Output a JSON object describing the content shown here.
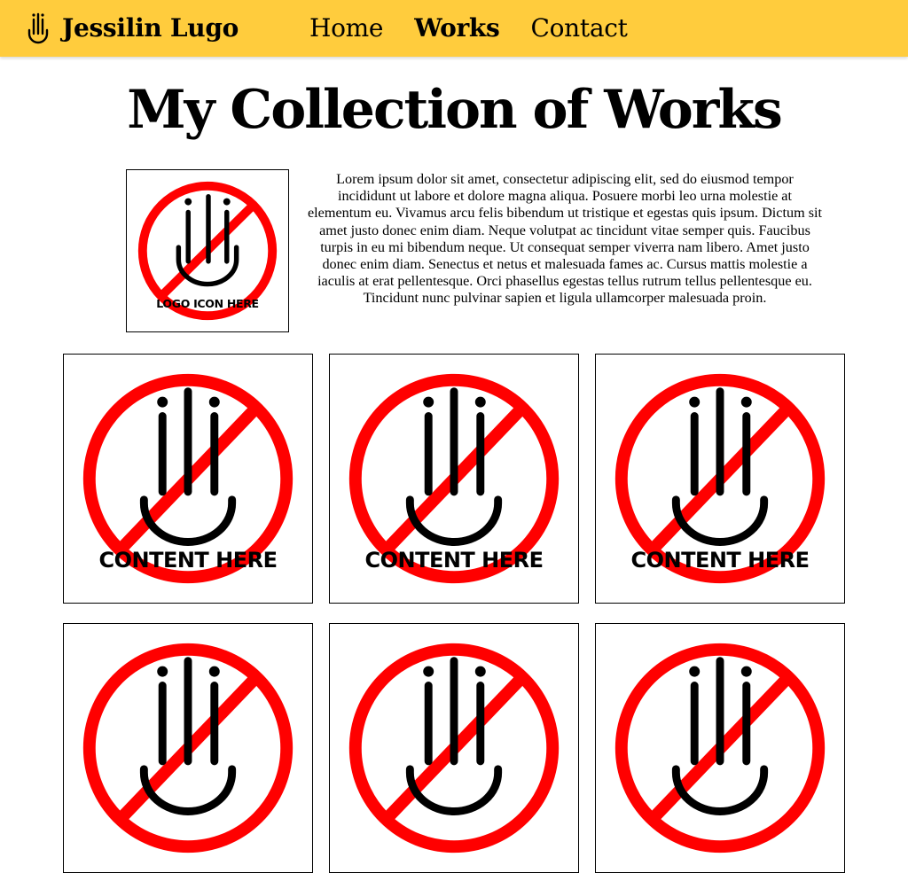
{
  "header": {
    "brand_name": "Jessilin Lugo",
    "brand_icon": "ili-hand-logo-icon",
    "nav": [
      {
        "label": "Home",
        "active": false
      },
      {
        "label": "Works",
        "active": true
      },
      {
        "label": "Contact",
        "active": false
      }
    ],
    "background_color": "#ffcc3d"
  },
  "main": {
    "title": "My Collection of Works",
    "intro": {
      "logo_placeholder_text": "LOGO ICON HERE",
      "paragraph": "Lorem ipsum dolor sit amet, consectetur adipiscing elit, sed do eiusmod tempor incididunt ut labore et dolore magna aliqua. Posuere morbi leo urna molestie at elementum eu. Vivamus arcu felis bibendum ut tristique et egestas quis ipsum. Dictum sit amet justo donec enim diam. Neque volutpat ac tincidunt vitae semper quis. Faucibus turpis in eu mi bibendum neque. Ut consequat semper viverra nam libero. Amet justo donec enim diam. Senectus et netus et malesuada fames ac. Cursus mattis molestie a iaculis at erat pellentesque. Orci phasellus egestas tellus rutrum tellus pellentesque eu. Tincidunt nunc pulvinar sapien et ligula ullamcorper malesuada proin."
    },
    "works": [
      {
        "label": "CONTENT HERE",
        "icon": "no-symbol-ili-hand-icon"
      },
      {
        "label": "CONTENT HERE",
        "icon": "no-symbol-ili-hand-icon"
      },
      {
        "label": "CONTENT HERE",
        "icon": "no-symbol-ili-hand-icon"
      },
      {
        "label": "",
        "icon": "no-symbol-ili-hand-icon"
      },
      {
        "label": "",
        "icon": "no-symbol-ili-hand-icon"
      },
      {
        "label": "",
        "icon": "no-symbol-ili-hand-icon"
      }
    ],
    "placeholder_colors": {
      "prohibition": "#ff0000",
      "hand": "#000000"
    }
  }
}
